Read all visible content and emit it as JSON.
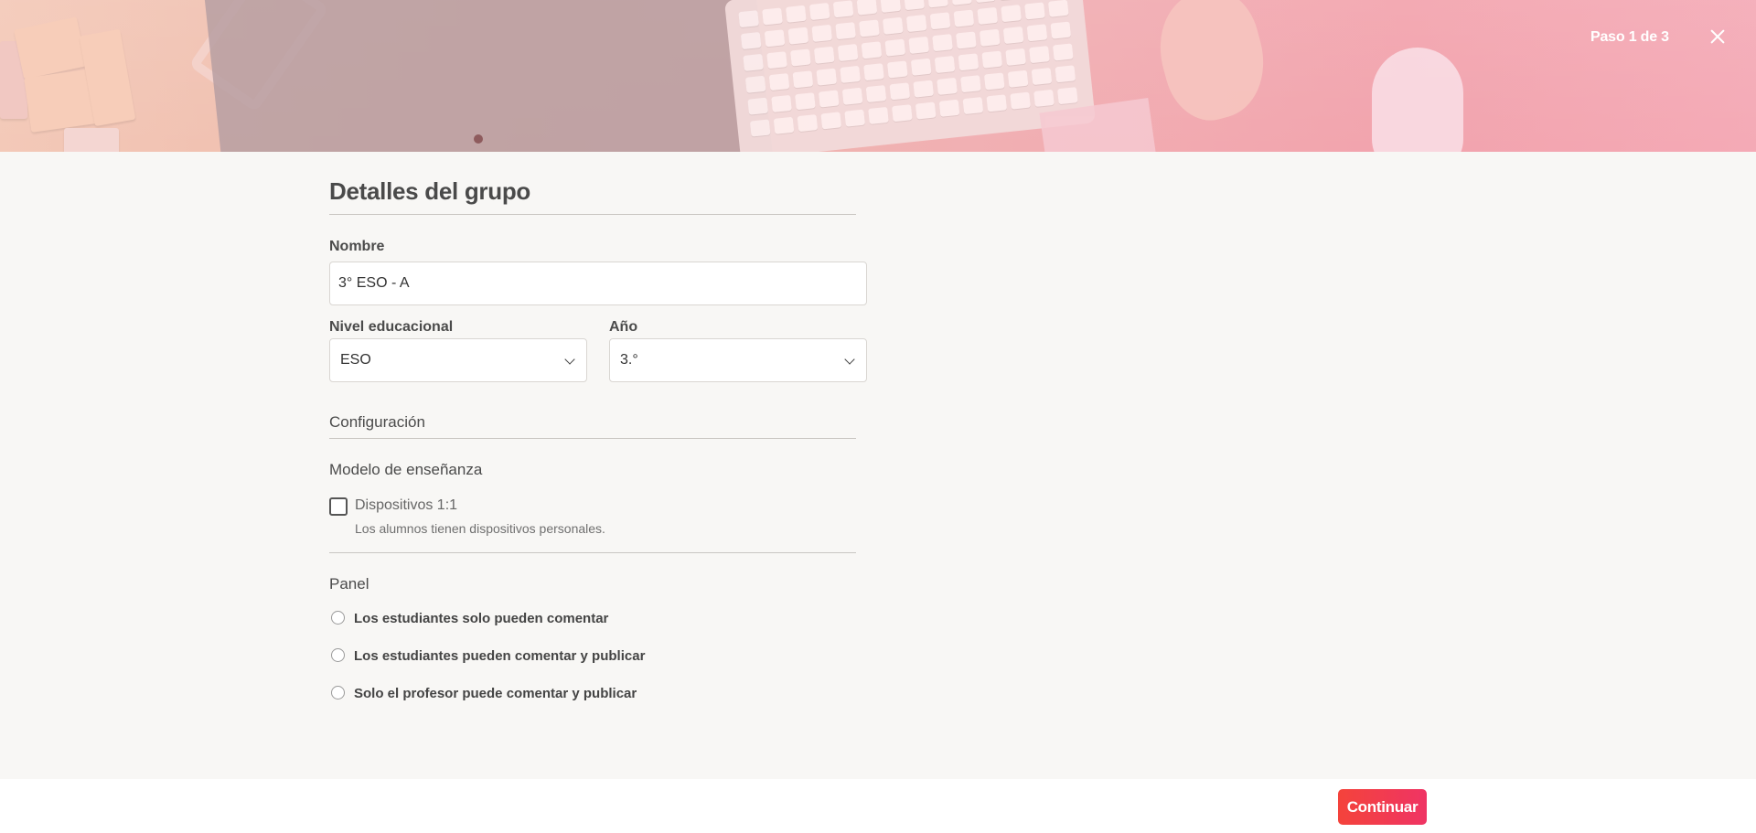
{
  "header": {
    "step_label": "Paso 1 de 3"
  },
  "form": {
    "title": "Detalles del grupo",
    "name": {
      "label": "Nombre",
      "value": "3° ESO - A"
    },
    "level": {
      "label": "Nivel educacional",
      "value": "ESO"
    },
    "year": {
      "label": "Año",
      "value": "3.°"
    },
    "config_title": "Configuración",
    "teaching_model": {
      "title": "Modelo de enseñanza",
      "devices_label": "Dispositivos 1:1",
      "devices_help": "Los alumnos tienen dispositivos personales.",
      "devices_checked": false
    },
    "panel": {
      "title": "Panel",
      "options": [
        {
          "label": "Los estudiantes solo pueden comentar",
          "selected": false
        },
        {
          "label": "Los estudiantes pueden comentar y publicar",
          "selected": false
        },
        {
          "label": "Solo el profesor puede comentar y publicar",
          "selected": false
        }
      ]
    }
  },
  "footer": {
    "continue_label": "Continuar"
  },
  "colors": {
    "accent": "#f43f4a",
    "background": "#f8f7f5"
  }
}
